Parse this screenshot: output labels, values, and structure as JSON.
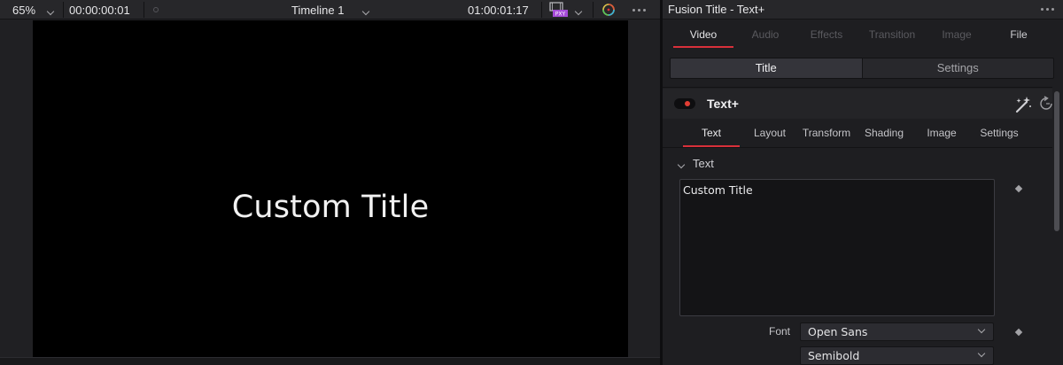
{
  "viewer": {
    "zoom": "65%",
    "timecode_left": "00:00:00:01",
    "timeline_name": "Timeline 1",
    "timecode_right": "01:00:01:17",
    "proxy_badge": "PXY",
    "canvas_text": "Custom Title"
  },
  "inspector": {
    "title": "Fusion Title - Text+",
    "main_tabs": [
      {
        "label": "Video",
        "state": "selected"
      },
      {
        "label": "Audio",
        "state": "disabled"
      },
      {
        "label": "Effects",
        "state": "disabled"
      },
      {
        "label": "Transition",
        "state": "disabled"
      },
      {
        "label": "Image",
        "state": "disabled"
      },
      {
        "label": "File",
        "state": "enabled"
      }
    ],
    "segments": {
      "title": "Title",
      "settings": "Settings"
    },
    "node": {
      "name": "Text+",
      "enabled": true
    },
    "sub_tabs": [
      {
        "label": "Text",
        "selected": true
      },
      {
        "label": "Layout",
        "selected": false
      },
      {
        "label": "Transform",
        "selected": false
      },
      {
        "label": "Shading",
        "selected": false
      },
      {
        "label": "Image",
        "selected": false
      },
      {
        "label": "Settings",
        "selected": false
      }
    ],
    "section_label": "Text",
    "styled_text": "Custom Title",
    "font_label": "Font",
    "font_family": "Open Sans",
    "font_style": "Semibold"
  },
  "colors": {
    "accent": "#d8303a",
    "toggle_on": "#e23d34",
    "canvas": "#000000"
  }
}
